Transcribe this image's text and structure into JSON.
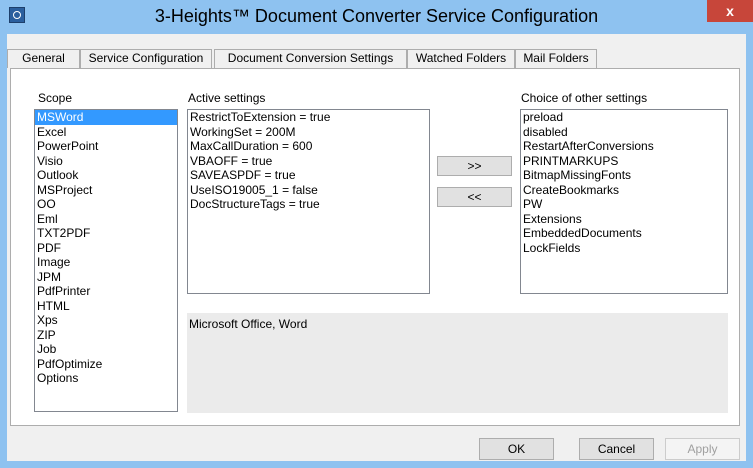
{
  "window": {
    "title": "3-Heights™ Document Converter Service Configuration",
    "close_label": "x"
  },
  "tabs": [
    {
      "label": "General"
    },
    {
      "label": "Service Configuration"
    },
    {
      "label": "Document Conversion Settings"
    },
    {
      "label": "Watched Folders"
    },
    {
      "label": "Mail Folders"
    }
  ],
  "scope": {
    "label": "Scope",
    "selected": "MSWord",
    "items": [
      "MSWord",
      "Excel",
      "PowerPoint",
      "Visio",
      "Outlook",
      "MSProject",
      "OO",
      "Eml",
      "TXT2PDF",
      "PDF",
      "Image",
      "JPM",
      "PdfPrinter",
      "HTML",
      "Xps",
      "ZIP",
      "Job",
      "PdfOptimize",
      "Options"
    ]
  },
  "active": {
    "label": "Active settings",
    "items": [
      "RestrictToExtension = true",
      "WorkingSet = 200M",
      "MaxCallDuration = 600",
      "VBAOFF = true",
      "SAVEASPDF = true",
      "UseISO19005_1 = false",
      "DocStructureTags = true"
    ]
  },
  "choices": {
    "label": "Choice of other settings",
    "items": [
      "preload",
      "disabled",
      "RestartAfterConversions",
      "PRINTMARKUPS",
      "BitmapMissingFonts",
      "CreateBookmarks",
      "PW",
      "Extensions",
      "EmbeddedDocuments",
      "LockFields"
    ]
  },
  "move": {
    "add_label": ">>",
    "remove_label": "<<"
  },
  "description": "Microsoft Office, Word",
  "footer": {
    "ok_label": "OK",
    "cancel_label": "Cancel",
    "apply_label": "Apply"
  },
  "colors": {
    "titlebar": "#8ec2f0",
    "selection": "#3399ff",
    "close": "#c7463a"
  }
}
